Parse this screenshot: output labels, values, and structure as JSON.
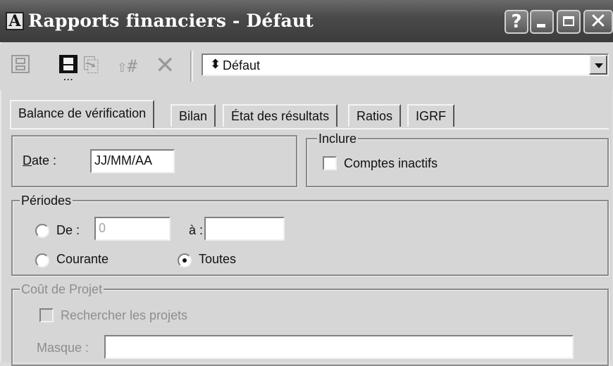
{
  "window": {
    "title": "Rapports financiers - Défaut",
    "app_icon_glyph": "A",
    "help_glyph": "?",
    "close_glyph": "✕"
  },
  "toolbar": {
    "profile_selected": "Défaut",
    "profile_icon": "pin-icon"
  },
  "tabs": [
    "Balance de vérification",
    "Bilan",
    "État des résultats",
    "Ratios",
    "IGRF"
  ],
  "active_tab": "Balance de vérification",
  "date_group": {
    "label_underlined": "D",
    "label_rest": "ate :",
    "date_value": "JJ/MM/AA"
  },
  "inclure_group": {
    "title": "Inclure",
    "comptes_inactifs_label": "Comptes inactifs",
    "comptes_inactifs_checked": false
  },
  "periodes_group": {
    "title": "Périodes",
    "de_label": "De :",
    "de_value": "0",
    "a_label": "à :",
    "a_value": "",
    "courante_label": "Courante",
    "toutes_label": "Toutes",
    "selected": "Toutes"
  },
  "cout_projet_group": {
    "title": "Coût de Projet",
    "rechercher_label": "Rechercher les projets",
    "masque_label": "Masque :",
    "masque_value": ""
  },
  "colors": {
    "title_bar": "#4a4a4a",
    "face": "#d6d6d6",
    "disabled_text": "#8e8e8e"
  }
}
